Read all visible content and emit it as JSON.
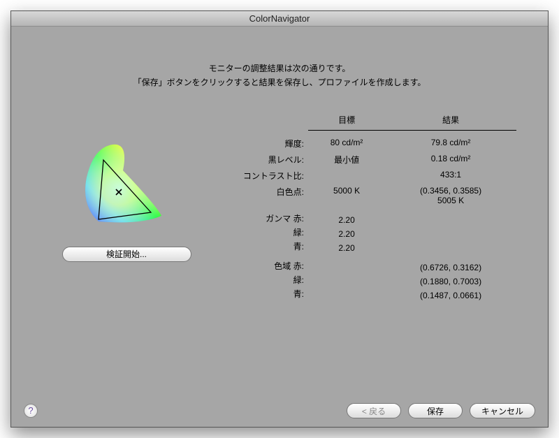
{
  "window": {
    "title": "ColorNavigator"
  },
  "intro": {
    "line1": "モニターの調整結果は次の通りです。",
    "line2": "「保存」ボタンをクリックすると結果を保存し、プロファイルを作成します。"
  },
  "columns": {
    "target": "目標",
    "result": "結果"
  },
  "rows": {
    "brightness": {
      "label": "輝度:",
      "target": "80 cd/m²",
      "result": "79.8 cd/m²"
    },
    "black": {
      "label": "黒レベル:",
      "target": "最小値",
      "result": "0.18 cd/m²"
    },
    "contrast": {
      "label": "コントラスト比:",
      "target": "",
      "result": "433:1"
    },
    "white": {
      "label": "白色点:",
      "target": "5000 K",
      "result_line1": "(0.3456, 0.3585)",
      "result_line2": "5005 K"
    },
    "gamma": {
      "label": "ガンマ",
      "r": {
        "label": "赤:",
        "target": "2.20"
      },
      "g": {
        "label": "緑:",
        "target": "2.20"
      },
      "b": {
        "label": "青:",
        "target": "2.20"
      }
    },
    "gamut": {
      "label": "色域",
      "r": {
        "label": "赤:",
        "result": "(0.6726, 0.3162)"
      },
      "g": {
        "label": "緑:",
        "result": "(0.1880, 0.7003)"
      },
      "b": {
        "label": "青:",
        "result": "(0.1487, 0.0661)"
      }
    }
  },
  "buttons": {
    "verify": "検証開始...",
    "back": "< 戻る",
    "save": "保存",
    "cancel": "キャンセル",
    "help": "?"
  }
}
